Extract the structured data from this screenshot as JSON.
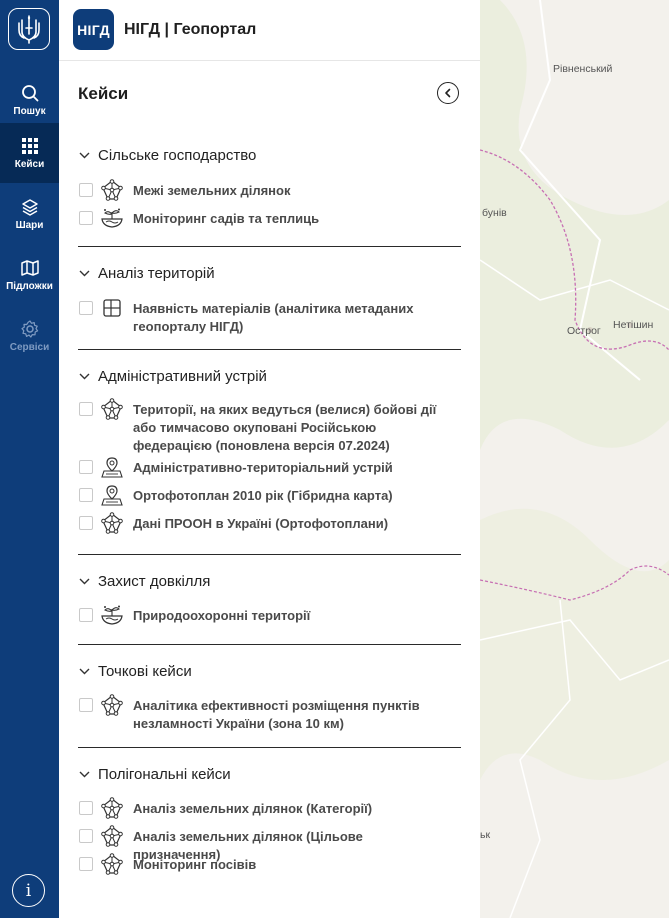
{
  "rail": {
    "items": [
      {
        "label": "Пошук",
        "icon": "search-icon"
      },
      {
        "label": "Кейси",
        "icon": "grid-icon"
      },
      {
        "label": "Шари",
        "icon": "layers-icon"
      },
      {
        "label": "Підложки",
        "icon": "map-icon"
      },
      {
        "label": "Сервіси",
        "icon": "gear-icon"
      }
    ],
    "active": "Кейси",
    "info_label": "i"
  },
  "header": {
    "logo_text": "НІГД",
    "title": "НІГД | Геопортал"
  },
  "panel": {
    "title": "Кейси"
  },
  "sections": [
    {
      "title": "Сільське господарство",
      "items": [
        {
          "label": "Межі земельних ділянок",
          "icon": "parcel-network-icon"
        },
        {
          "label": "Моніторинг садів та теплиць",
          "icon": "garden-bowl-icon"
        }
      ]
    },
    {
      "title": "Аналіз територій",
      "items": [
        {
          "label": "Наявність матеріалів (аналітика метаданих геопорталу НІГД)",
          "icon": "table-grid-icon"
        }
      ]
    },
    {
      "title": "Адміністративний устрій",
      "items": [
        {
          "label": "Території, на яких ведуться (велися) бойові дії або тимчасово окуповані Російською федерацією (поновлена версія 07.2024)",
          "icon": "parcel-network-icon"
        },
        {
          "label": "Адміністративно-територіальний устрій",
          "icon": "map-pin-icon"
        },
        {
          "label": "Ортофотоплан 2010 рік (Гібридна карта)",
          "icon": "map-pin-icon"
        },
        {
          "label": "Дані ПРООН в Україні (Ортофотоплани)",
          "icon": "parcel-network-icon"
        }
      ]
    },
    {
      "title": "Захист довкілля",
      "items": [
        {
          "label": "Природоохоронні території",
          "icon": "garden-bowl-icon"
        }
      ]
    },
    {
      "title": "Точкові кейси",
      "items": [
        {
          "label": "Аналітика ефективності розміщення пунктів незламності України (зона 10 км)",
          "icon": "parcel-network-icon"
        }
      ]
    },
    {
      "title": "Полігональні кейси",
      "items": [
        {
          "label": "Аналіз земельних ділянок (Категорії)",
          "icon": "parcel-network-icon"
        },
        {
          "label": "Аналіз земельних ділянок (Цільове призначення)",
          "icon": "parcel-network-icon"
        },
        {
          "label": "Моніторинг посівів",
          "icon": "parcel-network-icon"
        }
      ]
    }
  ],
  "map": {
    "labels": [
      "Рівненський",
      "Острог",
      "Нетішин",
      "бунів",
      "ьк"
    ]
  },
  "colors": {
    "rail": "#0e3d7a",
    "rail_active": "#062a56",
    "map_bg": "#f3f1ec",
    "border_line": "#c76fb3"
  }
}
